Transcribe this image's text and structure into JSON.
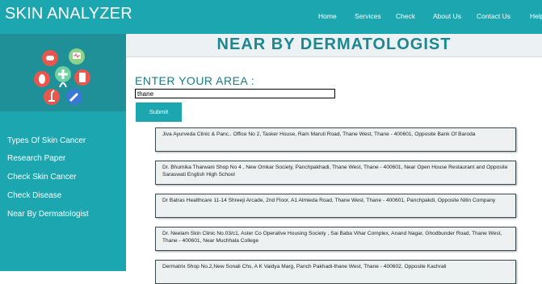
{
  "header": {
    "brand": "SKIN ANALYZER",
    "nav": [
      "Home",
      "Services",
      "Check",
      "About Us",
      "Contact Us",
      "Help"
    ]
  },
  "sidebar": {
    "links": [
      "Types Of Skin Cancer",
      "Research Paper",
      "Check Skin Cancer",
      "Check Disease",
      "Near By Dermatologist"
    ]
  },
  "main": {
    "title": "NEAR BY DERMATOLOGIST",
    "enter_label": "ENTER YOUR AREA :",
    "area_value": "thane",
    "submit_label": "Submit",
    "results": [
      "Jiva Ayurveda Clinic & Panc.. Office No 2, Tasker House, Ram Maruti Road, Thane West, Thane - 400601, Opposite Bank Of Baroda",
      "Dr. Bhumika Tharwani Shop No 4 , New Omkar Society, Panchpakhadi, Thane West, Thane - 400601, Near Open House Restaurant and Opposite Saraswati English High School",
      "Dr Batras Healthcare 11-14 Shreeji Arcade, 2nd Floor, A1 Almieda Road, Thane West, Thane - 400601, Panchpakdi, Opposite Nitin Company",
      "Dr. Neelam Skin Clinic No.03/c1, Aster Co Operative Housing Society , Sai Baba Vihar Complex, Anand Nagar, Ghodbunder Road, Thane West, Thane - 400601, Near Muchhala College",
      "Dermatrix Shop No.2,New Sonali Chs, A K Vaidya Marg, Panch Pakhadi-thane West, Thane - 400602, Opposite Kachrali"
    ]
  },
  "colors": {
    "primary": "#1ca7b0",
    "logo_bg": "#1f8f98",
    "title": "#1d8791"
  }
}
